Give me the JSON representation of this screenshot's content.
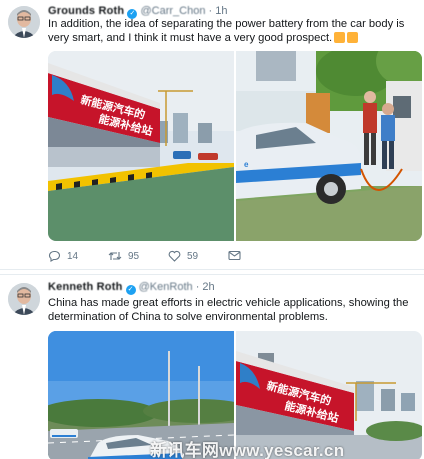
{
  "tweets": [
    {
      "author_name": "Grounds Roth",
      "handle": "@Carr_Chon",
      "time": "1h",
      "text": "In addition, the idea of separating the power battery from the car body is very smart, and I think it must have a very good prospect.",
      "stats": {
        "replies": "14",
        "retweets": "95",
        "likes": "59"
      },
      "media": [
        {
          "sign_line1": "新能源汽车的",
          "sign_line2": "能源补给站"
        },
        {
          "car_logo": "e"
        }
      ]
    },
    {
      "author_name": "Kenneth Roth",
      "handle": "@KenRoth",
      "time": "2h",
      "text": "China has made great efforts in electric vehicle applications, showing the determination of China to solve environmental problems.",
      "media": [
        {
          "description": ""
        },
        {
          "sign_line1": "新能源汽车的",
          "sign_line2": "能源补给站"
        }
      ]
    }
  ],
  "icons": {
    "reply": "reply-icon",
    "retweet": "retweet-icon",
    "like": "heart-icon",
    "message": "envelope-icon",
    "emoji": "thumbs-up-emoji"
  },
  "colors": {
    "text": "#14171a",
    "secondary": "#657786",
    "verified": "#1da1f2",
    "divider": "#e6ecf0",
    "station_red": "#c6142a"
  },
  "watermark": "新讯车网www.yescar.cn"
}
